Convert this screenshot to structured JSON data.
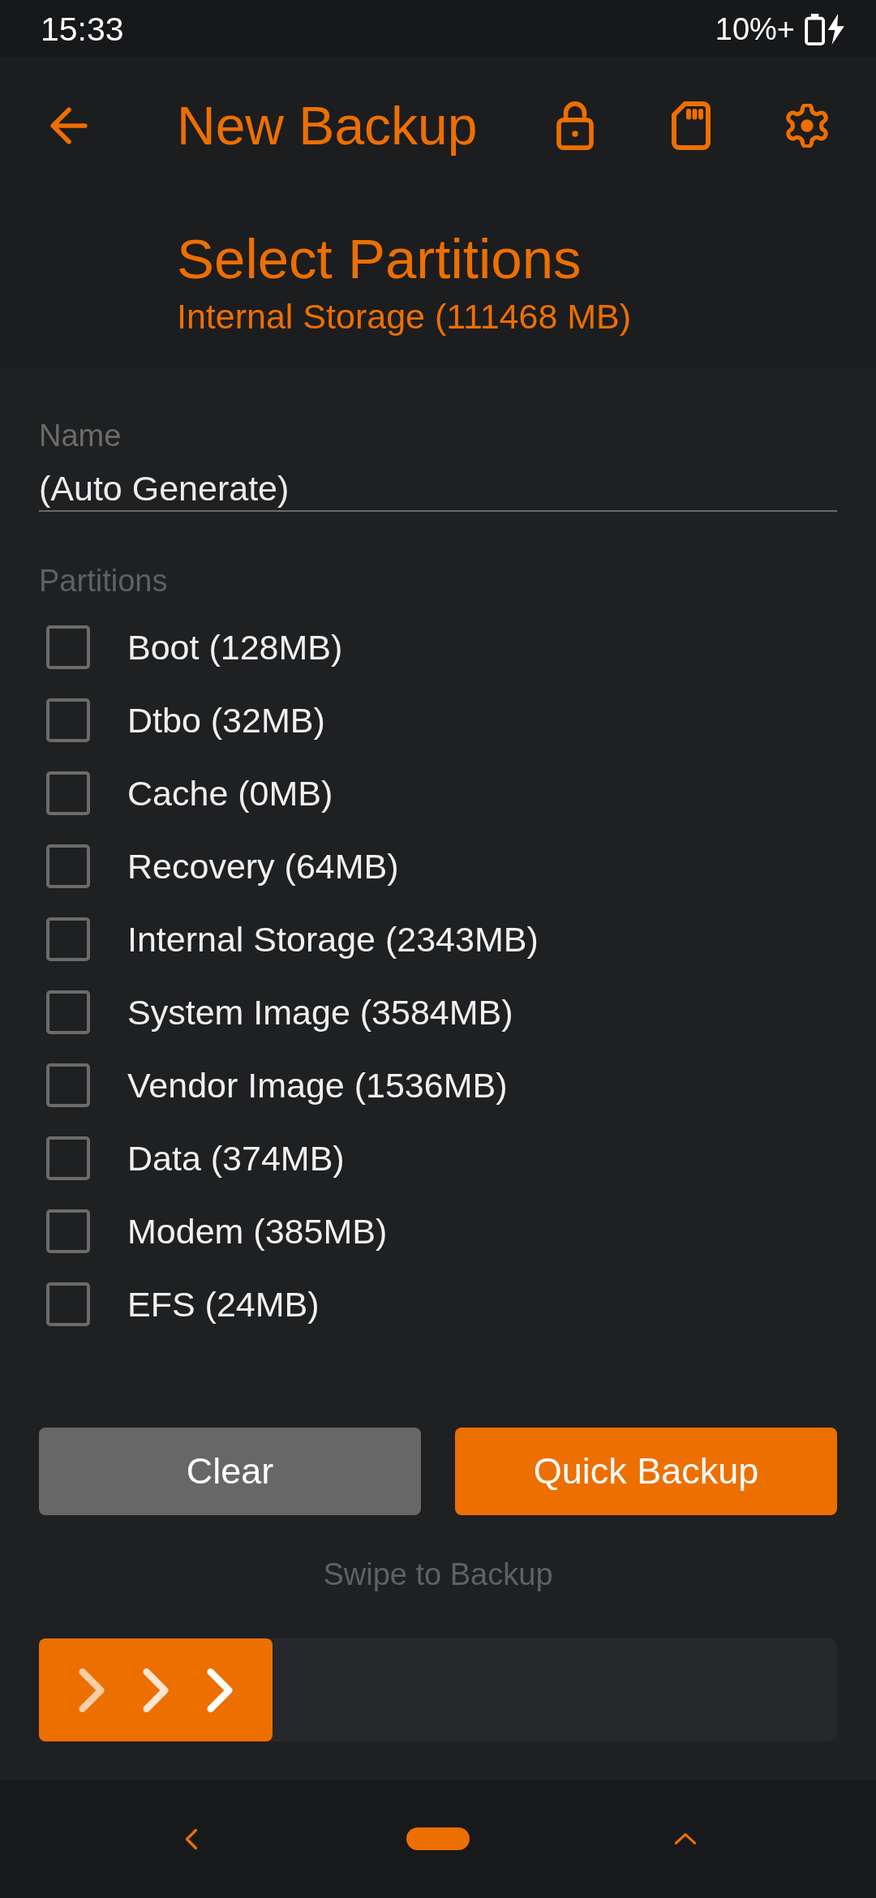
{
  "status_bar": {
    "time": "15:33",
    "battery": "10%+"
  },
  "header": {
    "title": "New Backup",
    "heading": "Select Partitions",
    "subheading": "Internal Storage (111468 MB)"
  },
  "name_field": {
    "label": "Name",
    "value": "(Auto Generate)"
  },
  "partitions": {
    "label": "Partitions",
    "items": [
      {
        "label": "Boot (128MB)",
        "checked": false
      },
      {
        "label": "Dtbo (32MB)",
        "checked": false
      },
      {
        "label": "Cache (0MB)",
        "checked": false
      },
      {
        "label": "Recovery (64MB)",
        "checked": false
      },
      {
        "label": "Internal Storage (2343MB)",
        "checked": false
      },
      {
        "label": "System Image (3584MB)",
        "checked": false
      },
      {
        "label": "Vendor Image (1536MB)",
        "checked": false
      },
      {
        "label": "Data (374MB)",
        "checked": false
      },
      {
        "label": "Modem (385MB)",
        "checked": false
      },
      {
        "label": "EFS (24MB)",
        "checked": false
      }
    ]
  },
  "buttons": [
    {
      "label": "Clear",
      "kind": "secondary"
    },
    {
      "label": "Quick Backup",
      "kind": "primary"
    }
  ],
  "swipe": {
    "label": "Swipe to Backup"
  }
}
